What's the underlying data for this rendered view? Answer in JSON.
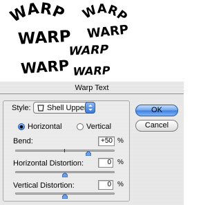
{
  "samples": {
    "words": [
      "WARP",
      "WARP",
      "WARP",
      "WARP",
      "WARP",
      "WARP",
      "WARP"
    ]
  },
  "dialog": {
    "title": "Warp Text",
    "style": {
      "label": "Style:",
      "selected": "Shell Upper",
      "icon": "shell-shape-icon"
    },
    "orientation": {
      "options": [
        "Horizontal",
        "Vertical"
      ],
      "selected": "Horizontal"
    },
    "bend": {
      "label": "Bend:",
      "value": "+50",
      "unit": "%",
      "level": 0.75
    },
    "horizontal_distortion": {
      "label": "Horizontal Distortion:",
      "value": "0",
      "unit": "%",
      "level": 0.5
    },
    "vertical_distortion": {
      "label": "Vertical Distortion:",
      "value": "0",
      "unit": "%",
      "level": 0.5
    },
    "buttons": {
      "ok": "OK",
      "cancel": "Cancel"
    },
    "colors": {
      "accent": "#3b7ad9"
    }
  }
}
